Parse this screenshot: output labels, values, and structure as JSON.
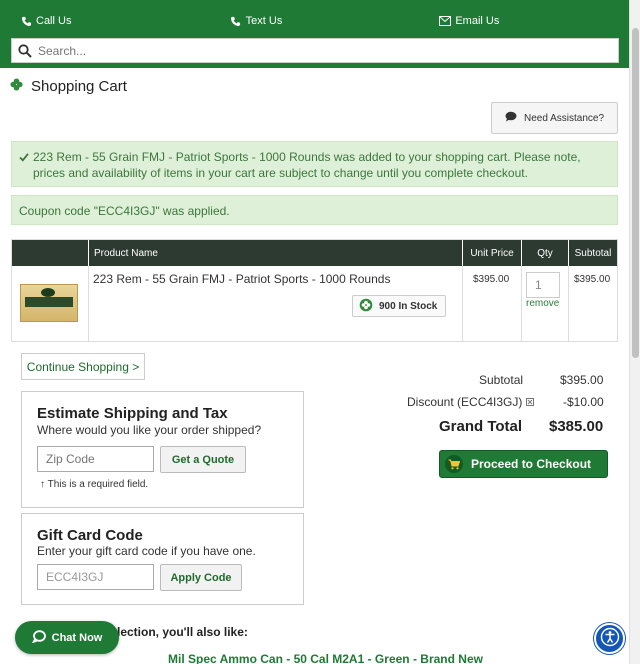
{
  "topbar": {
    "call_label": "Call Us",
    "text_label": "Text Us",
    "email_label": "Email Us",
    "search_placeholder": "Search..."
  },
  "page": {
    "title": "Shopping Cart",
    "assist_label": "Need Assistance?"
  },
  "alerts": {
    "added": "223 Rem - 55 Grain FMJ - Patriot Sports - 1000 Rounds was added to your shopping cart. Please note, prices and availability of items in your cart are subject to change until you complete checkout.",
    "coupon": "Coupon code \"ECC4I3GJ\" was applied."
  },
  "cart": {
    "headers": {
      "product": "Product Name",
      "unit_price": "Unit Price",
      "qty": "Qty",
      "subtotal": "Subtotal"
    },
    "item": {
      "name": "223 Rem - 55 Grain FMJ - Patriot Sports - 1000 Rounds",
      "stock": "900 In Stock",
      "unit_price": "$395.00",
      "qty": "1",
      "remove_label": "remove",
      "subtotal": "$395.00"
    }
  },
  "continue_label": "Continue Shopping >",
  "shipping": {
    "title": "Estimate Shipping and Tax",
    "subtitle": "Where would you like your order shipped?",
    "zip_placeholder": "Zip Code",
    "quote_label": "Get a Quote",
    "required_note": "This is a required field."
  },
  "gift": {
    "title": "Gift Card Code",
    "subtitle": "Enter your gift card code if you have one.",
    "code_value": "ECC4I3GJ",
    "apply_label": "Apply Code"
  },
  "totals": {
    "subtotal_label": "Subtotal",
    "subtotal_value": "$395.00",
    "discount_label": "Discount (ECC4I3GJ)",
    "discount_value": "-$10.00",
    "grand_label": "Grand Total",
    "grand_value": "$385.00"
  },
  "checkout_label": "Proceed to Checkout",
  "recommend": {
    "heading": "lection, you'll also like:",
    "item": "Mil Spec Ammo Can - 50 Cal M2A1 - Green - Brand New"
  },
  "chat_label": "Chat Now",
  "colors": {
    "brand_green": "#1f7a35",
    "dark_header": "#2d3a31",
    "success_bg": "#dff0d8",
    "access_blue": "#1456b5"
  }
}
